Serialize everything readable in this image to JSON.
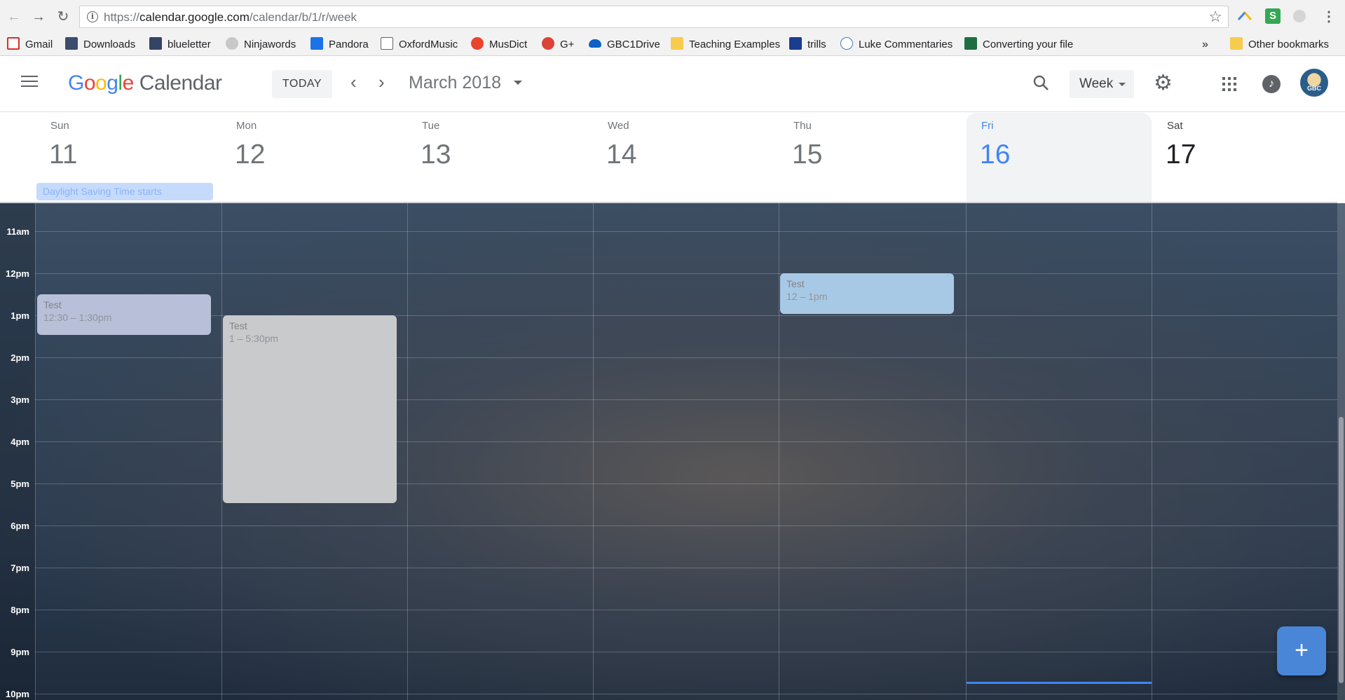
{
  "browser": {
    "url_scheme": "https://",
    "url_host": "calendar.google.com",
    "url_path": "/calendar/b/1/r/week",
    "bookmarks": [
      {
        "label": "Gmail",
        "color": "#d93025"
      },
      {
        "label": "Downloads",
        "color": "#3c4c6c"
      },
      {
        "label": "blueletter",
        "color": "#334466"
      },
      {
        "label": "Ninjawords",
        "color": "#888888"
      },
      {
        "label": "Pandora",
        "color": "#1a73e8"
      },
      {
        "label": "OxfordMusic",
        "color": "#666666"
      },
      {
        "label": "MusDict",
        "color": "#e8452c"
      },
      {
        "label": "G+",
        "color": "#db4437"
      },
      {
        "label": "GBC1Drive",
        "color": "#0f62c5"
      },
      {
        "label": "Teaching Examples",
        "color": "#f7cb4d"
      },
      {
        "label": "trills",
        "color": "#1a3d8f"
      },
      {
        "label": "Luke Commentaries",
        "color": "#4a7ab5"
      },
      {
        "label": "Converting your file",
        "color": "#1d6f42"
      }
    ],
    "overflow": "»",
    "other_bookmarks": "Other bookmarks"
  },
  "app": {
    "logo_google": [
      "G",
      "o",
      "o",
      "g",
      "l",
      "e"
    ],
    "logo_product": "Calendar",
    "today_label": "TODAY",
    "prev_icon": "‹",
    "next_icon": "›",
    "month_title": "March 2018",
    "view_label": "Week",
    "avatar_text": "GBC"
  },
  "days": [
    {
      "name": "Sun",
      "num": "11"
    },
    {
      "name": "Mon",
      "num": "12"
    },
    {
      "name": "Tue",
      "num": "13"
    },
    {
      "name": "Wed",
      "num": "14"
    },
    {
      "name": "Thu",
      "num": "15"
    },
    {
      "name": "Fri",
      "num": "16"
    },
    {
      "name": "Sat",
      "num": "17"
    }
  ],
  "allday_event": "Daylight Saving Time starts",
  "time_labels": [
    "11am",
    "12pm",
    "1pm",
    "2pm",
    "3pm",
    "4pm",
    "5pm",
    "6pm",
    "7pm",
    "8pm",
    "9pm",
    "10pm"
  ],
  "events": [
    {
      "title": "Test",
      "time": "12:30 – 1:30pm",
      "day": "Sun"
    },
    {
      "title": "Test",
      "time": "1 – 5:30pm",
      "day": "Mon"
    },
    {
      "title": "Test",
      "time": "12 – 1pm",
      "day": "Thu"
    }
  ],
  "fab_icon": "+",
  "colors": {
    "accent": "#4285f4",
    "event_sun": "#b8bfd8",
    "event_mon": "#c8cacc",
    "event_thu": "#a8c9e6"
  }
}
